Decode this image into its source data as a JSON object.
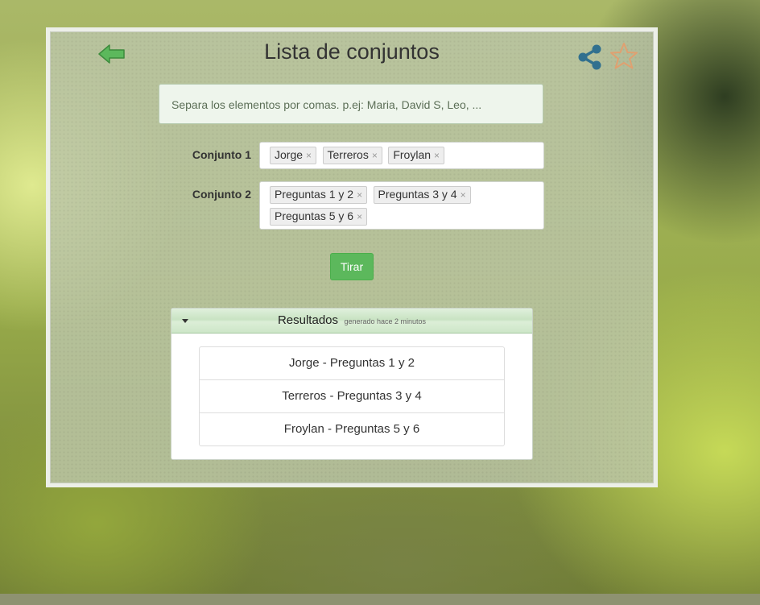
{
  "header": {
    "title": "Lista de conjuntos",
    "back_icon": "arrow-left-icon",
    "share_icon": "share-icon",
    "favorite_icon": "star-icon",
    "colors": {
      "back": "#5cb85c",
      "share": "#31708f",
      "favorite": "#e0a070"
    }
  },
  "hint": "Separa los elementos por comas. p.ej: Maria, David S, Leo, ...",
  "sets": [
    {
      "label": "Conjunto 1",
      "tags": [
        "Jorge",
        "Terreros",
        "Froylan"
      ]
    },
    {
      "label": "Conjunto 2",
      "tags": [
        "Preguntas 1 y 2",
        "Preguntas 3 y 4",
        "Preguntas 5 y 6"
      ]
    }
  ],
  "tag_remove_symbol": "×",
  "action": {
    "label": "Tirar",
    "color": "#5cb85c"
  },
  "results": {
    "title": "Resultados",
    "subtitle": "generado hace 2 minutos",
    "items": [
      "Jorge - Preguntas 1 y 2",
      "Terreros - Preguntas 3 y 4",
      "Froylan - Preguntas 5 y 6"
    ]
  }
}
